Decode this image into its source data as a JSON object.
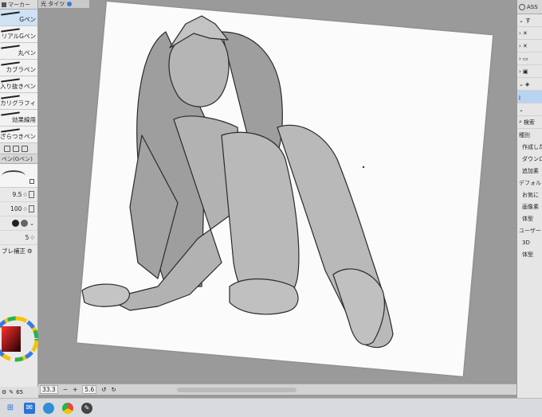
{
  "left_panel": {
    "tab_label": "マーカー",
    "brushes": [
      {
        "label": "Gペン",
        "selected": true
      },
      {
        "label": "リアルGペン",
        "selected": false
      },
      {
        "label": "丸ペン",
        "selected": false
      },
      {
        "label": "カブラペン",
        "selected": false
      },
      {
        "label": "入り抜きペン",
        "selected": false
      },
      {
        "label": "カリグラフィ",
        "selected": false
      },
      {
        "label": "効果線用",
        "selected": false
      },
      {
        "label": "ざらつきペン",
        "selected": false
      }
    ],
    "subtool_title": "ペン(Gペン)",
    "brush_size": "9.5",
    "opacity": "100",
    "aa_value": "5",
    "stabilize_label": "ブレ補正",
    "status_zoom": "65",
    "icons": [
      "gear-icon",
      "pen-icon",
      "color-wheel-icon"
    ]
  },
  "canvas": {
    "doc_tab": "光 タイツ",
    "zoom": "33.3",
    "angle": "5.6",
    "minus_label": "−",
    "plus_label": "+"
  },
  "right_panel": {
    "header": "ASS",
    "rows": [
      {
        "label": "す",
        "selected": false
      },
      {
        "label": "",
        "selected": false
      },
      {
        "label": "",
        "selected": false
      },
      {
        "label": "",
        "selected": false
      },
      {
        "label": "",
        "selected": false
      },
      {
        "label": "",
        "selected": false
      },
      {
        "label": "",
        "selected": false
      },
      {
        "label": "",
        "selected": true
      },
      {
        "label": "",
        "selected": false
      }
    ],
    "search_label": "検索",
    "items": [
      {
        "label": "種別",
        "header": true
      },
      {
        "label": "作成した",
        "header": false
      },
      {
        "label": "ダウンロ",
        "header": false
      },
      {
        "label": "追加素",
        "header": false
      },
      {
        "label": "デフォルト",
        "header": true
      },
      {
        "label": "お気に",
        "header": false
      },
      {
        "label": "画像素",
        "header": false
      },
      {
        "label": "体型",
        "header": false
      },
      {
        "label": "ユーザー",
        "header": true
      },
      {
        "label": "3D",
        "header": false
      },
      {
        "label": "体型",
        "header": false
      }
    ]
  },
  "taskbar": {
    "icons": [
      "windows-icon",
      "mail-icon",
      "edge-icon",
      "chrome-icon",
      "clip-studio-icon"
    ]
  },
  "colors": {
    "selected_bg": "#cfe1f5",
    "accent": "#3c7bd8",
    "panel_bg": "#e9e9e9",
    "canvas_bg": "#9a9a9a"
  }
}
